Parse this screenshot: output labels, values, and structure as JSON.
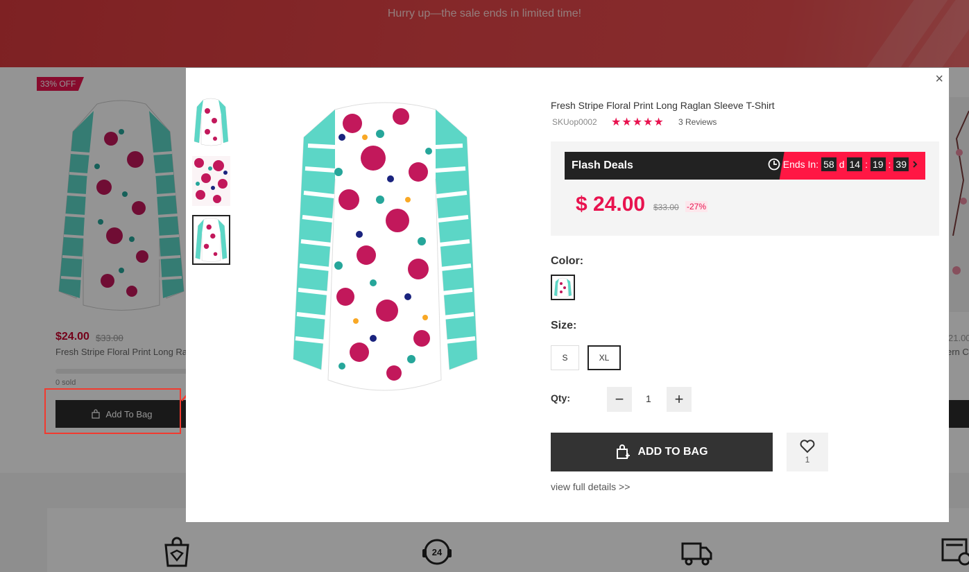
{
  "banner": {
    "text": "Hurry up—the sale ends in limited time!"
  },
  "background_product": {
    "discount_badge": "33% OFF",
    "price": "$24.00",
    "old_price": "$33.00",
    "title": "Fresh Stripe Floral Print Long Ra",
    "sold": "0 sold",
    "add_to_bag_label": "Add To Bag"
  },
  "background_product_right": {
    "price_fragment": "21.00",
    "title_fragment": "ern C"
  },
  "modal": {
    "close_label": "×",
    "product_title": "Fresh Stripe Floral Print Long Raglan Sleeve T-Shirt",
    "sku": "SKUop0002",
    "stars": "★★★★★",
    "reviews": "3 Reviews",
    "flash_deals_label": "Flash Deals",
    "ends_in_label": "Ends In:",
    "countdown": {
      "days": "58",
      "day_unit": "d",
      "hours": "14",
      "minutes": "19",
      "seconds": "39",
      "sep": ":"
    },
    "price": "$ 24.00",
    "old_price": "$33.00",
    "discount": "-27%",
    "color_label": "Color:",
    "size_label": "Size:",
    "sizes": [
      "S",
      "XL"
    ],
    "selected_size": "XL",
    "qty_label": "Qty:",
    "qty_value": "1",
    "qty_minus": "−",
    "qty_plus": "+",
    "add_to_bag_label": "ADD TO BAG",
    "wishlist_count": "1",
    "view_full_details": "view full details >>"
  },
  "colors": {
    "accent": "#e8134f",
    "banner_red": "#e54548",
    "dark_button": "#333333",
    "highlight_red": "#f23a2f"
  },
  "icons": [
    "bag-icon",
    "clock-icon",
    "chevron-right-icon",
    "heart-icon",
    "close-icon",
    "shopping-bag-shield-icon",
    "support-24-icon",
    "delivery-truck-icon",
    "invoice-check-icon"
  ]
}
